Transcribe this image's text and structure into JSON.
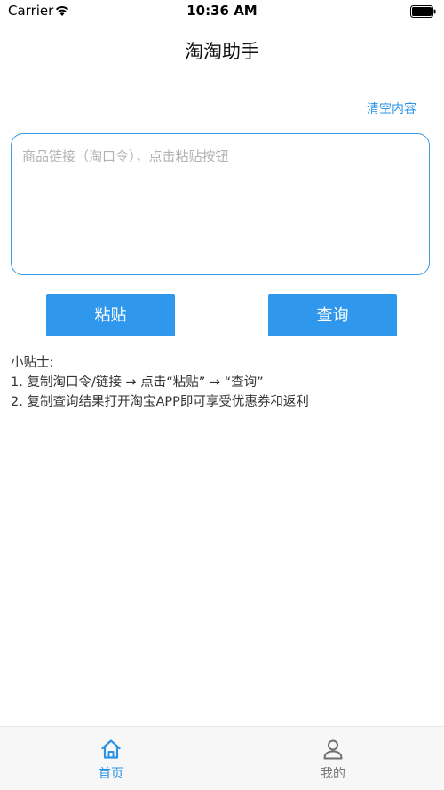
{
  "status_bar": {
    "carrier": "Carrier",
    "time": "10:36 AM"
  },
  "nav": {
    "title": "淘淘助手"
  },
  "actions": {
    "clear_label": "清空内容"
  },
  "input": {
    "value": "",
    "placeholder": "商品链接（淘口令），点击粘贴按钮"
  },
  "buttons": {
    "paste_label": "粘贴",
    "query_label": "查询"
  },
  "tips": {
    "title": "小贴士:",
    "lines": [
      "1. 复制淘口令/链接 → 点击“粘贴” → “查询”",
      "2. 复制查询结果打开淘宝APP即可享受优惠券和返利"
    ]
  },
  "tab_bar": {
    "items": [
      {
        "label": "首页",
        "icon": "home-icon",
        "active": true
      },
      {
        "label": "我的",
        "icon": "user-icon",
        "active": false
      }
    ]
  },
  "colors": {
    "accent": "#2f97ec",
    "link": "#2a93e6",
    "border": "#3a9be8"
  }
}
